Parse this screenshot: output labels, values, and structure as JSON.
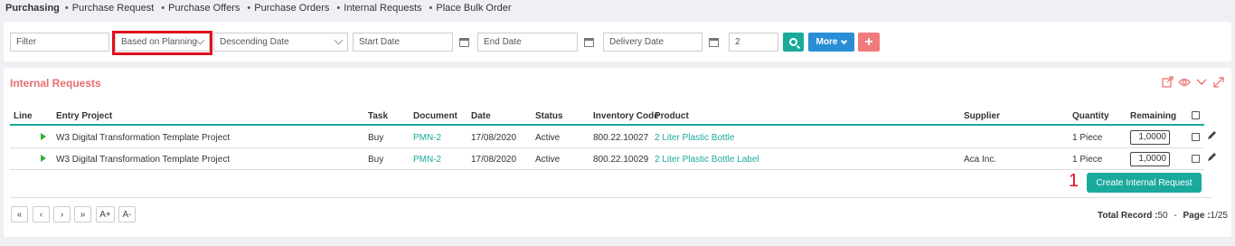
{
  "breadcrumb": {
    "root": "Purchasing",
    "items": [
      "Purchase Request",
      "Purchase Offers",
      "Purchase Orders",
      "Internal Requests",
      "Place Bulk Order"
    ]
  },
  "filters": {
    "filter_placeholder": "Filter",
    "plan_select": "Based on Planning",
    "sort_select": "Descending Date",
    "start_date_placeholder": "Start Date",
    "end_date_placeholder": "End Date",
    "delivery_date_placeholder": "Delivery Date",
    "count_value": "2",
    "more_label": "More",
    "add_label": "+"
  },
  "panel": {
    "title": "Internal Requests"
  },
  "table": {
    "headers": {
      "line": "Line",
      "entry_project": "Entry Project",
      "task": "Task",
      "document": "Document",
      "date": "Date",
      "status": "Status",
      "inventory_code": "Inventory Code",
      "product": "Product",
      "supplier": "Supplier",
      "quantity": "Quantity",
      "remaining": "Remaining"
    },
    "rows": [
      {
        "entry_project": "W3 Digital Transformation Template Project",
        "task": "Buy",
        "document": "PMN-2",
        "date": "17/08/2020",
        "status": "Active",
        "inventory_code": "800.22.10027",
        "product": "2 Liter Plastic Bottle",
        "supplier": "",
        "quantity": "1 Piece",
        "remaining": "1,0000"
      },
      {
        "entry_project": "W3 Digital Transformation Template Project",
        "task": "Buy",
        "document": "PMN-2",
        "date": "17/08/2020",
        "status": "Active",
        "inventory_code": "800.22.10029",
        "product": "2 Liter Plastic Bottle Label",
        "supplier": "Aca Inc.",
        "quantity": "1 Piece",
        "remaining": "1,0000"
      }
    ]
  },
  "actions": {
    "step_number": "1",
    "create_label": "Create Internal Request"
  },
  "pagination": {
    "first": "«",
    "prev": "‹",
    "next": "›",
    "last": "»",
    "font_up": "A+",
    "font_down": "A-",
    "total_label": "Total Record :",
    "total_value": "50",
    "separator": "-",
    "page_label": "Page :",
    "page_value": "1/25"
  },
  "colors": {
    "accent": "#1aaa9c",
    "title": "#e86f6f",
    "more": "#2a8ed6",
    "add": "#ef7b7b",
    "highlight": "#e0101e"
  }
}
